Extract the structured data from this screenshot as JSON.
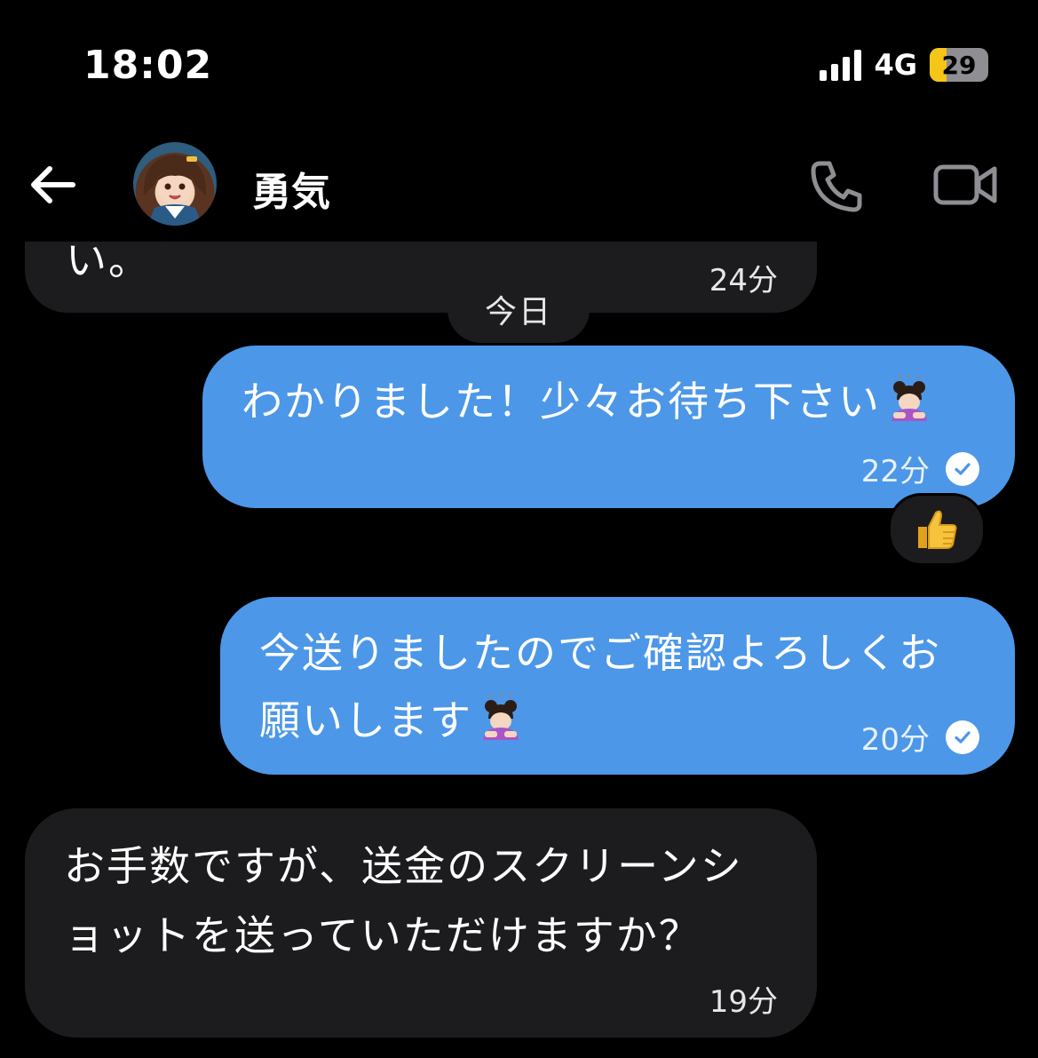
{
  "status_bar": {
    "time": "18:02",
    "network": "4G",
    "battery": "29",
    "battery_level": 0.29
  },
  "header": {
    "contact_name": "勇気",
    "back_icon": "arrow-left-icon",
    "call_icon": "phone-icon",
    "video_icon": "video-camera-icon"
  },
  "messages": [
    {
      "direction": "incoming",
      "text": "い。",
      "time": "24分"
    },
    {
      "direction": "outgoing",
      "text": "わかりました！少々お待ち下さい",
      "emoji": "person-bowing",
      "time": "22分",
      "read": true,
      "reaction": "👍"
    },
    {
      "direction": "outgoing",
      "text_line1": "今送りましたのでご確認よろしくお",
      "text_line2": "願いします",
      "emoji": "person-bowing",
      "time": "20分",
      "read": true
    },
    {
      "direction": "incoming",
      "text_line1": "お手数ですが、送金のスクリーンシ",
      "text_line2": "ョットを送っていただけますか？",
      "time": "19分"
    }
  ],
  "day_separator": "今日",
  "colors": {
    "background": "#000000",
    "incoming_bubble": "#1c1c1e",
    "outgoing_bubble": "#4c97e8",
    "icon_gray": "#8e8e93"
  }
}
